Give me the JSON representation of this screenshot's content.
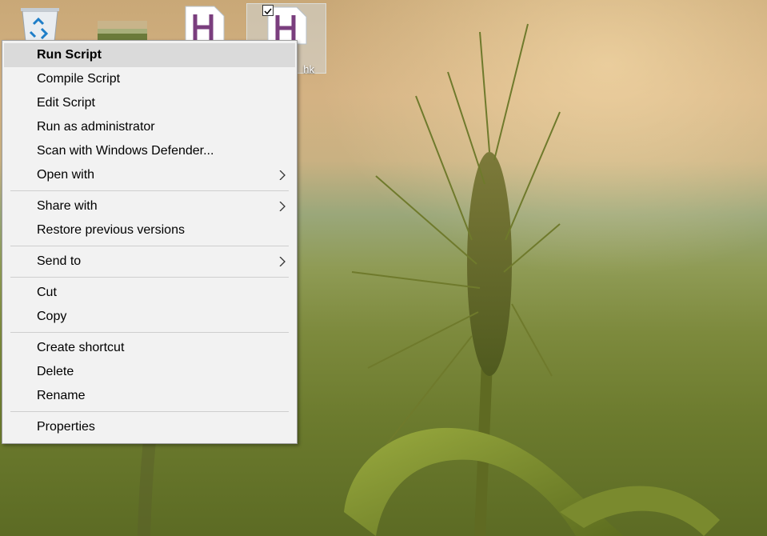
{
  "desktop": {
    "icons": [
      {
        "name": "recycle-bin-icon",
        "caption": ""
      },
      {
        "name": "image-file-icon",
        "caption": ""
      },
      {
        "name": "ahk-script-icon",
        "caption": ""
      },
      {
        "name": "ahk-script-icon-selected",
        "caption": "hk",
        "selected": true
      }
    ]
  },
  "context_menu": {
    "items": [
      {
        "label": "Run Script",
        "bold": true,
        "highlighted": true
      },
      {
        "label": "Compile Script"
      },
      {
        "label": "Edit Script"
      },
      {
        "label": "Run as administrator"
      },
      {
        "label": "Scan with Windows Defender..."
      },
      {
        "label": "Open with",
        "submenu": true
      },
      {
        "separator": true
      },
      {
        "label": "Share with",
        "submenu": true
      },
      {
        "label": "Restore previous versions"
      },
      {
        "separator": true
      },
      {
        "label": "Send to",
        "submenu": true
      },
      {
        "separator": true
      },
      {
        "label": "Cut"
      },
      {
        "label": "Copy"
      },
      {
        "separator": true
      },
      {
        "label": "Create shortcut"
      },
      {
        "label": "Delete"
      },
      {
        "label": "Rename"
      },
      {
        "separator": true
      },
      {
        "label": "Properties"
      }
    ]
  },
  "colors": {
    "menu_background": "#f2f2f2",
    "menu_highlight": "#dadada",
    "ahk_icon_letter": "#7a3e7e"
  }
}
